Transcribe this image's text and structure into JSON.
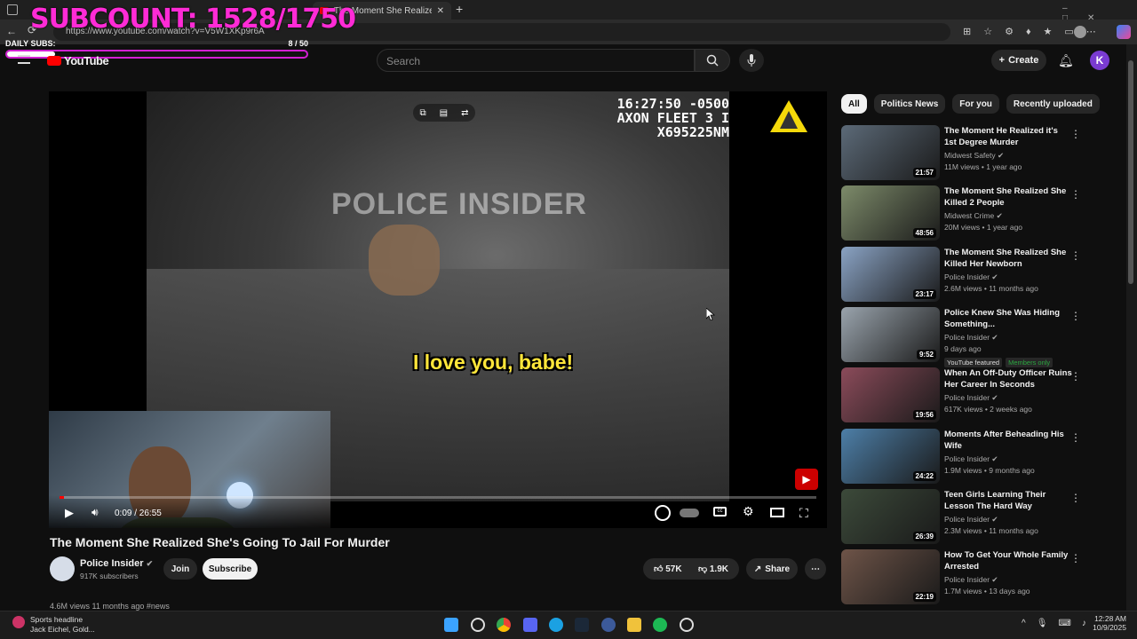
{
  "overlay": {
    "subcount": "SUBCOUNT: 1528/1750",
    "daily_label": "DAILY SUBS:",
    "daily_count": "8 / 50",
    "daily_progress": 0.16
  },
  "browser": {
    "tabs": [
      {
        "label": "The Moment She Realized She's"
      }
    ],
    "url": "https://www.youtube.com/watch?v=V5W1XKp9r6A"
  },
  "youtube": {
    "logo": "YouTube",
    "search_placeholder": "Search",
    "create_label": "Create",
    "avatar_letter": "K"
  },
  "video": {
    "timestamp": "16:27:50 -0500",
    "camera_id": "AXON FLEET 3 I X695225NM",
    "watermark": "POLICE INSIDER",
    "subtitle": "I love you, babe!",
    "time": "0:09 / 26:55",
    "progress": 0.006,
    "title": "The Moment She Realized She's Going To Jail For Murder",
    "channel": "Police Insider",
    "subscribers": "917K subscribers",
    "join_label": "Join",
    "subscribe_label": "Subscribe",
    "likes": "57K",
    "dislikes": "1.9K",
    "share_label": "Share",
    "desc_preview": "4.6M views  11 months ago  #news"
  },
  "chips": [
    "All",
    "Politics News",
    "For you",
    "Recently uploaded"
  ],
  "recommendations": [
    {
      "title": "The Moment He Realized it's 1st Degree Murder",
      "channel": "Midwest Safety",
      "meta": "11M views • 1 year ago",
      "duration": "21:57",
      "color": "#5c6a78"
    },
    {
      "title": "The Moment She Realized She Killed 2 People",
      "channel": "Midwest Crime",
      "meta": "20M views • 1 year ago",
      "duration": "48:56",
      "color": "#7d8b6a"
    },
    {
      "title": "The Moment She Realized She Killed Her Newborn",
      "channel": "Police Insider",
      "meta": "2.6M views • 11 months ago",
      "duration": "23:17",
      "color": "#8aa3c4"
    },
    {
      "title": "Police Knew She Was Hiding Something...",
      "channel": "Police Insider",
      "meta": "9 days ago",
      "duration": "9:52",
      "color": "#9aa4ad",
      "badges": [
        "YouTube featured",
        "Members only"
      ]
    },
    {
      "title": "When An Off-Duty Officer Ruins Her Career In Seconds",
      "channel": "Police Insider",
      "meta": "617K views • 2 weeks ago",
      "duration": "19:56",
      "color": "#8b4b5a"
    },
    {
      "title": "Moments After Beheading His Wife",
      "channel": "Police Insider",
      "meta": "1.9M views • 9 months ago",
      "duration": "24:22",
      "color": "#4d7fa8"
    },
    {
      "title": "Teen Girls Learning Their Lesson The Hard Way",
      "channel": "Police Insider",
      "meta": "2.3M views • 11 months ago",
      "duration": "26:39",
      "color": "#3c4a3a"
    },
    {
      "title": "How To Get Your Whole Family Arrested",
      "channel": "Police Insider",
      "meta": "1.7M views • 13 days ago",
      "duration": "22:19",
      "color": "#6e5448"
    }
  ],
  "taskbar": {
    "news_title": "Sports headline",
    "news_sub": "Jack Eichel, Gold...",
    "time": "12:28 AM",
    "date": "10/9/2025"
  }
}
